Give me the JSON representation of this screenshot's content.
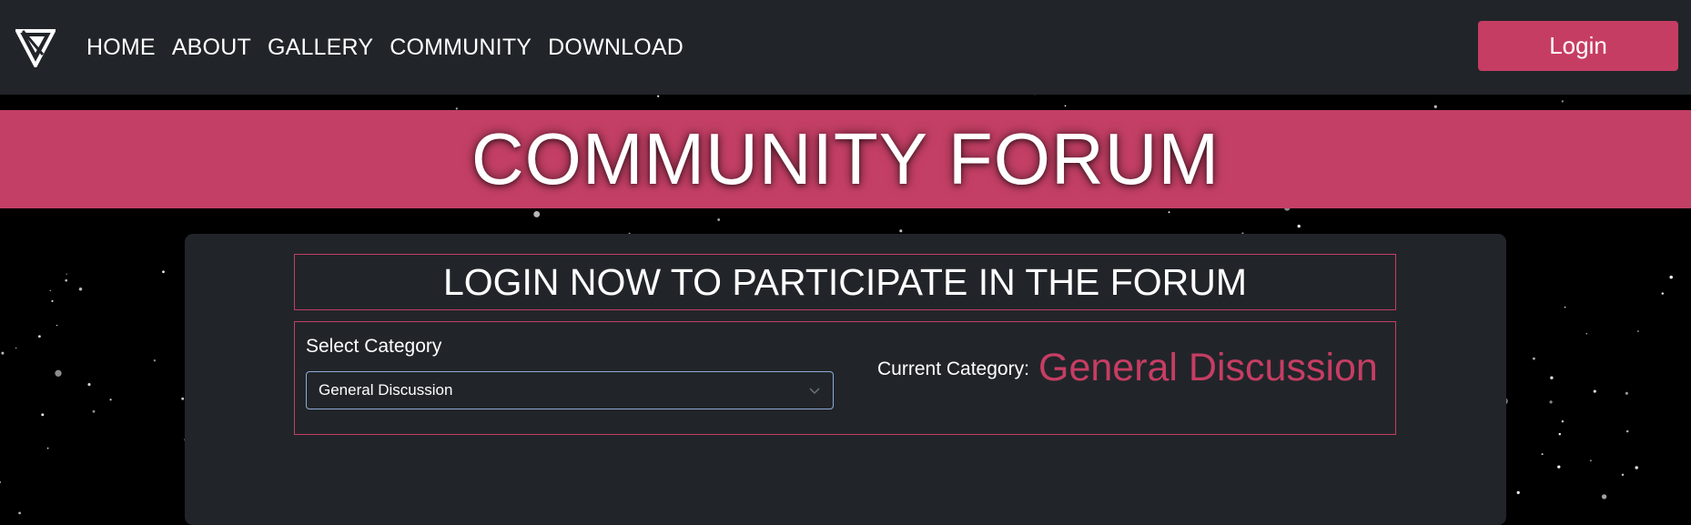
{
  "nav": {
    "logo_icon": "brand-logo-icon",
    "links": [
      "HOME",
      "ABOUT",
      "GALLERY",
      "COMMUNITY",
      "DOWNLOAD"
    ],
    "login_label": "Login"
  },
  "banner": {
    "title": "COMMUNITY FORUM"
  },
  "forum": {
    "login_notice": "LOGIN NOW TO PARTICIPATE IN THE FORUM",
    "select_label": "Select Category",
    "selected_category": "General Discussion",
    "current_category_label": "Current Category:",
    "current_category_value": "General Discussion"
  },
  "colors": {
    "accent": "#c63d63",
    "navbar_bg": "#212529",
    "background": "#000000"
  }
}
